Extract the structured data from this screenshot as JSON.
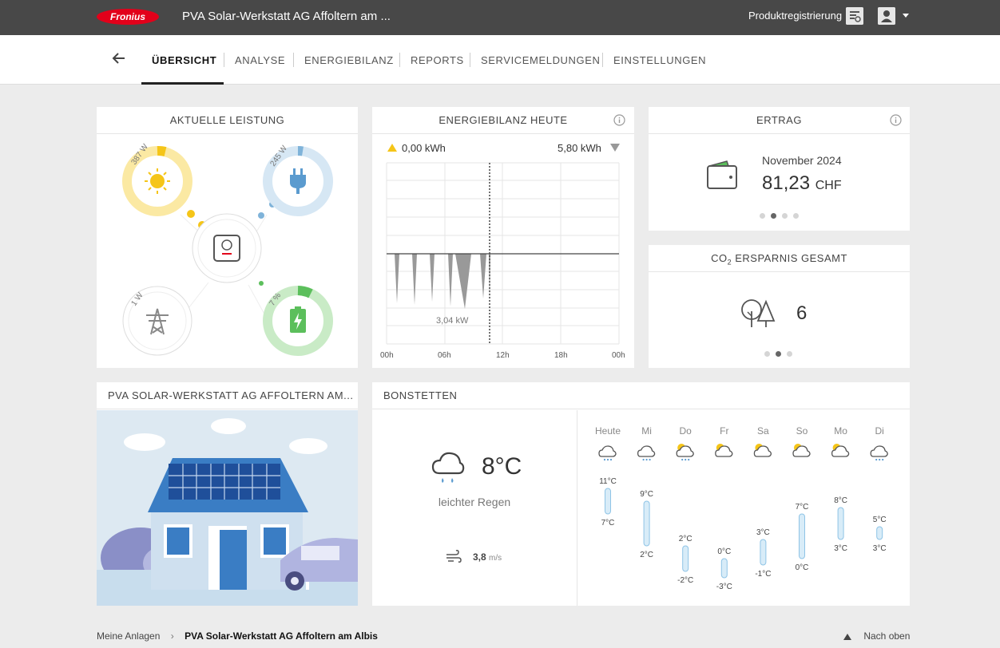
{
  "header": {
    "app_title": "PVA Solar-Werkstatt AG Affoltern am ...",
    "product_registration": "Produktregistrierung",
    "brand_color": "#e2001a"
  },
  "nav": {
    "tabs": [
      {
        "label": "ÜBERSICHT",
        "active": true
      },
      {
        "label": "ANALYSE"
      },
      {
        "label": "ENERGIEBILANZ"
      },
      {
        "label": "REPORTS"
      },
      {
        "label": "SERVICEMELDUNGEN"
      },
      {
        "label": "EINSTELLUNGEN"
      }
    ]
  },
  "aktuelle_leistung": {
    "title": "AKTUELLE LEISTUNG",
    "pv": {
      "value": "387 W",
      "color": "#f5c518"
    },
    "load": {
      "value": "245 W",
      "color": "#7fb3d9"
    },
    "grid": {
      "value": "1 W"
    },
    "battery": {
      "value": "7 %",
      "color": "#5cbf5c"
    }
  },
  "energiebilanz": {
    "title": "ENERGIEBILANZ HEUTE",
    "produced": "0,00 kWh",
    "consumed": "5,80 kWh",
    "peak_label": "3,04 kW",
    "x_ticks": [
      "00h",
      "06h",
      "12h",
      "18h",
      "00h"
    ]
  },
  "ertrag": {
    "title": "ERTRAG",
    "period": "November 2024",
    "amount": "81,23",
    "currency": "CHF"
  },
  "co2": {
    "title_prefix": "CO",
    "title_sub": "2",
    "title_suffix": " ERSPARNIS GESAMT",
    "value": "6"
  },
  "anlage": {
    "title": "PVA SOLAR-WERKSTATT AG AFFOLTERN AM..."
  },
  "weather": {
    "title": "BONSTETTEN",
    "current_temp": "8°C",
    "current_desc": "leichter Regen",
    "wind_value": "3,8",
    "wind_unit": "m/s",
    "days": [
      {
        "day": "Heute",
        "max": "11°C",
        "min": "7°C",
        "hi": 11,
        "lo": 7
      },
      {
        "day": "Mi",
        "max": "9°C",
        "min": "2°C",
        "hi": 9,
        "lo": 2
      },
      {
        "day": "Do",
        "max": "2°C",
        "min": "-2°C",
        "hi": 2,
        "lo": -2
      },
      {
        "day": "Fr",
        "max": "0°C",
        "min": "-3°C",
        "hi": 0,
        "lo": -3
      },
      {
        "day": "Sa",
        "max": "3°C",
        "min": "-1°C",
        "hi": 3,
        "lo": -1
      },
      {
        "day": "So",
        "max": "7°C",
        "min": "0°C",
        "hi": 7,
        "lo": 0
      },
      {
        "day": "Mo",
        "max": "8°C",
        "min": "3°C",
        "hi": 8,
        "lo": 3
      },
      {
        "day": "Di",
        "max": "5°C",
        "min": "3°C",
        "hi": 5,
        "lo": 3
      }
    ]
  },
  "footer": {
    "crumb_root": "Meine Anlagen",
    "crumb_current": "PVA Solar-Werkstatt AG Affoltern am Albis",
    "back_to_top": "Nach oben"
  }
}
